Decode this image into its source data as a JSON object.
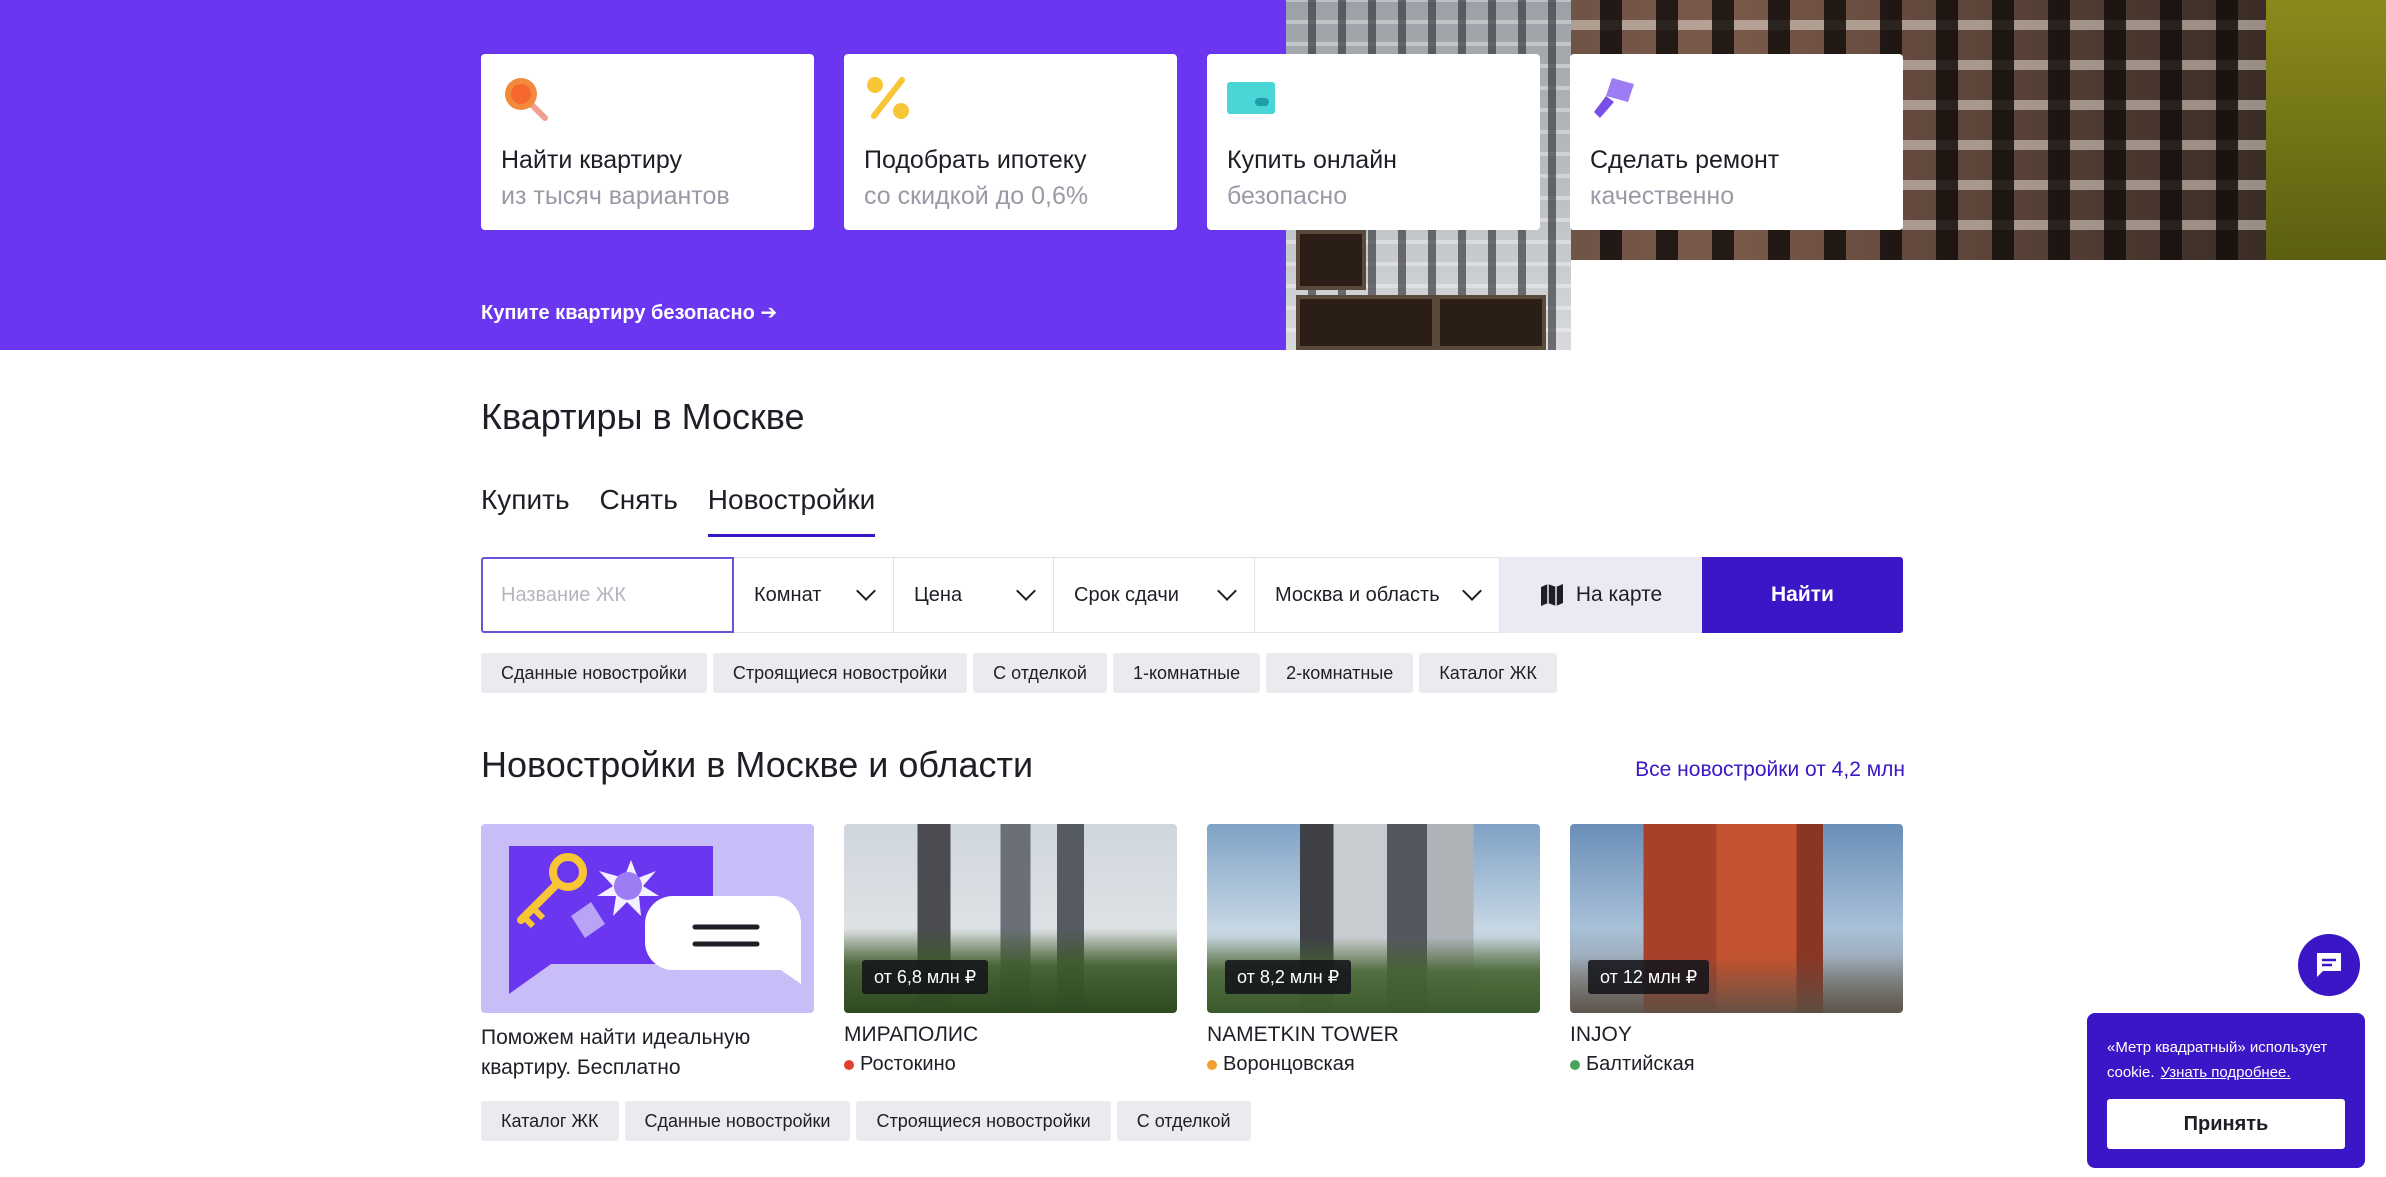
{
  "hero": {
    "cards": [
      {
        "title": "Найти квартиру",
        "subtitle": "из тысяч вариантов",
        "icon": "search-icon"
      },
      {
        "title": "Подобрать ипотеку",
        "subtitle": "со скидкой до 0,6%",
        "icon": "percent-icon"
      },
      {
        "title": "Купить онлайн",
        "subtitle": "безопасно",
        "icon": "card-icon"
      },
      {
        "title": "Сделать ремонт",
        "subtitle": "качественно",
        "icon": "paint-roller-icon"
      }
    ],
    "link": "Купите квартиру безопасно ➔"
  },
  "search_section": {
    "title": "Квартиры в Москве",
    "tabs": [
      "Купить",
      "Снять",
      "Новостройки"
    ],
    "active_tab": "Новостройки",
    "input_placeholder": "Название ЖК",
    "selects": {
      "rooms": "Комнат",
      "price": "Цена",
      "deadline": "Срок сдачи",
      "region": "Москва и область"
    },
    "map_label": "На карте",
    "find_label": "Найти",
    "chips": [
      "Сданные новостройки",
      "Строящиеся новостройки",
      "С отделкой",
      "1-комнатные",
      "2-комнатные",
      "Каталог ЖК"
    ]
  },
  "listings": {
    "title": "Новостройки в Москве и области",
    "all_link": "Все новостройки от 4,2 млн",
    "promo": {
      "text": "Поможем найти идеальную квартиру. Бесплатно"
    },
    "cards": [
      {
        "name": "МИРАПОЛИС",
        "metro": "Ростокино",
        "price": "от 6,8 млн ₽",
        "metro_color": "#e0402e"
      },
      {
        "name": "NAMETKIN TOWER",
        "metro": "Воронцовская",
        "price": "от 8,2 млн ₽",
        "metro_color": "#f0a030"
      },
      {
        "name": "INJOY",
        "metro": "Балтийская",
        "price": "от 12 млн ₽",
        "metro_color": "#4aa35a"
      }
    ],
    "chips": [
      "Каталог ЖК",
      "Сданные новостройки",
      "Строящиеся новостройки",
      "С отделкой"
    ]
  },
  "cookie": {
    "text": "«Метр квадратный» использует cookie.",
    "link": "Узнать подробнее.",
    "accept": "Принять"
  },
  "colors": {
    "accent": "#3b16c6",
    "hero": "#6a36f0",
    "promo_bg": "#c9bdf7"
  }
}
